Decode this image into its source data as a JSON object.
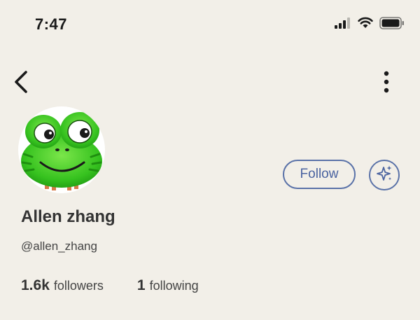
{
  "status_bar": {
    "time": "7:47",
    "icons": [
      "cellular-signal-icon",
      "wifi-icon",
      "battery-icon"
    ]
  },
  "nav": {
    "back_icon": "chevron-left-icon",
    "more_icon": "more-vertical-icon"
  },
  "profile": {
    "avatar_icon": "frog-avatar-icon",
    "display_name": "Allen zhang",
    "username": "@allen_zhang",
    "follow_label": "Follow",
    "sparkle_icon": "sparkle-icon"
  },
  "stats": {
    "followers_count": "1.6k",
    "followers_label": "followers",
    "following_count": "1",
    "following_label": "following"
  },
  "colors": {
    "background": "#f2efe8",
    "accent": "#4a63a0",
    "text": "#333333"
  }
}
